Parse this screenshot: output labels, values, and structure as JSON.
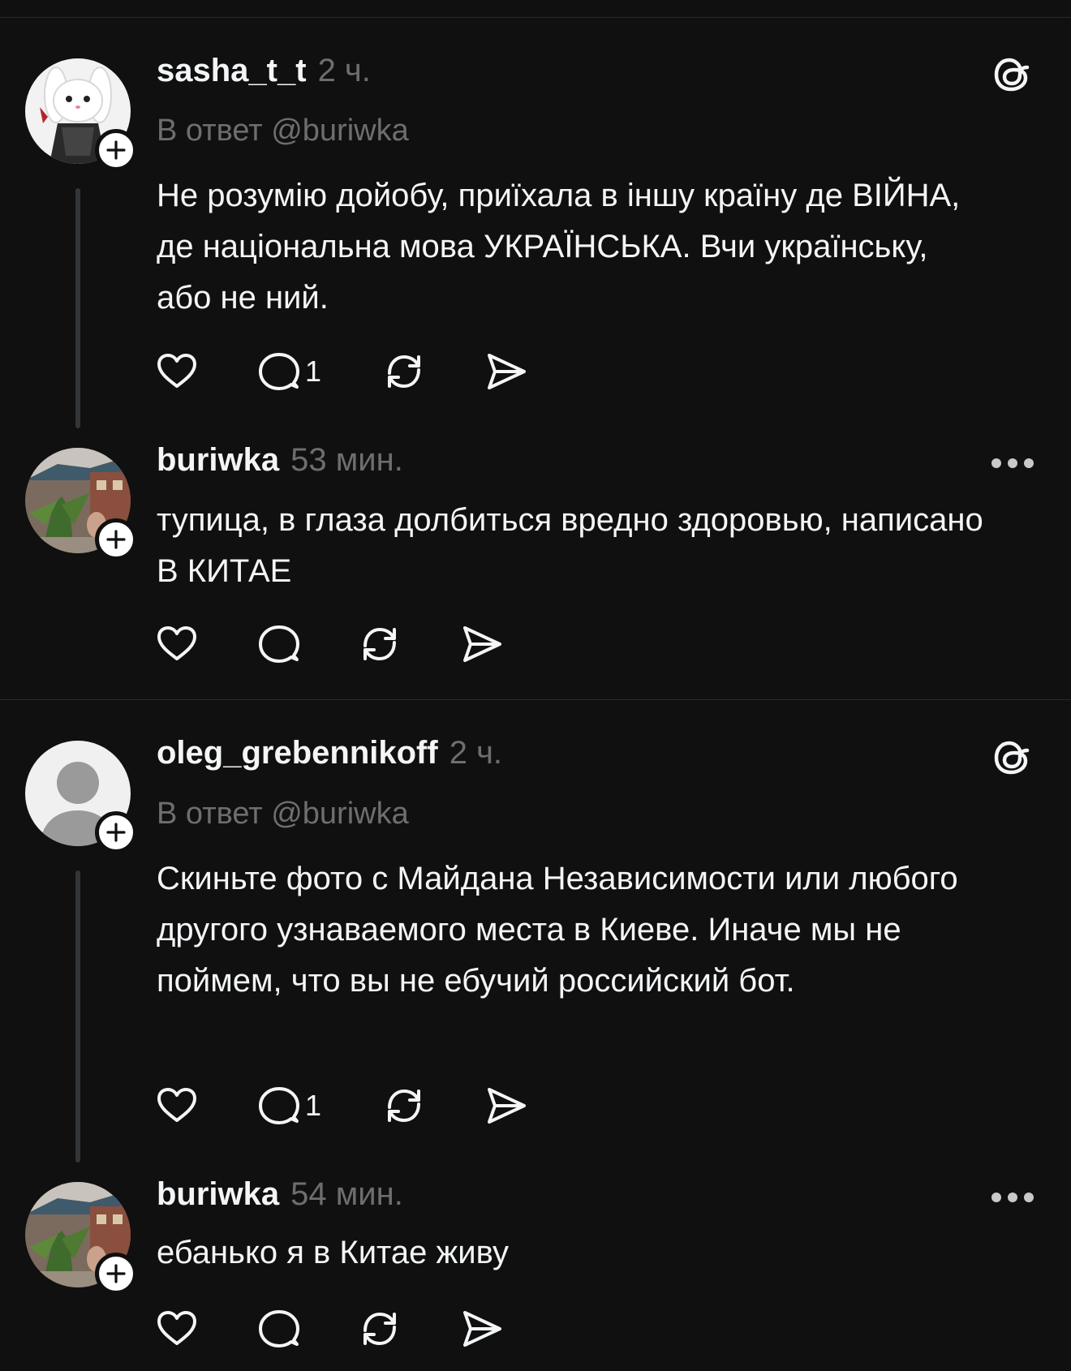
{
  "posts": [
    {
      "username": "sasha_t_t",
      "time": "2 ч.",
      "reply_to": "В ответ @buriwka",
      "text": "Не розумію дойобу, приїхала в іншу країну де ВІЙНА, де національна мова УКРАЇНСЬКА. Вчи українську, або не ний.",
      "reply_count": "1",
      "avatar": "cartoon-bunny-avatar",
      "corner_icon": "threads-logo-icon"
    },
    {
      "username": "buriwka",
      "time": "53 мин.",
      "text": "тупица, в глаза долбиться вредно здоровью, написано В КИТАЕ",
      "avatar": "photo-avatar",
      "corner_icon": "more-icon"
    },
    {
      "username": "oleg_grebennikoff",
      "time": "2 ч.",
      "reply_to": "В ответ @buriwka",
      "text": "Скиньте фото с Майдана Независимости или любого другого узнаваемого места в Киеве. Иначе мы не поймем, что вы не ебучий российский бот.",
      "reply_count": "1",
      "avatar": "default-avatar",
      "corner_icon": "threads-logo-icon"
    },
    {
      "username": "buriwka",
      "time": "54 мин.",
      "text": "ебанько я в Китае живу",
      "avatar": "photo-avatar",
      "corner_icon": "more-icon"
    }
  ],
  "colors": {
    "background": "#101010",
    "text": "#f3f5f7",
    "muted": "#6e6e6e",
    "divider": "#2a2a2a",
    "thread_line": "#333638"
  }
}
